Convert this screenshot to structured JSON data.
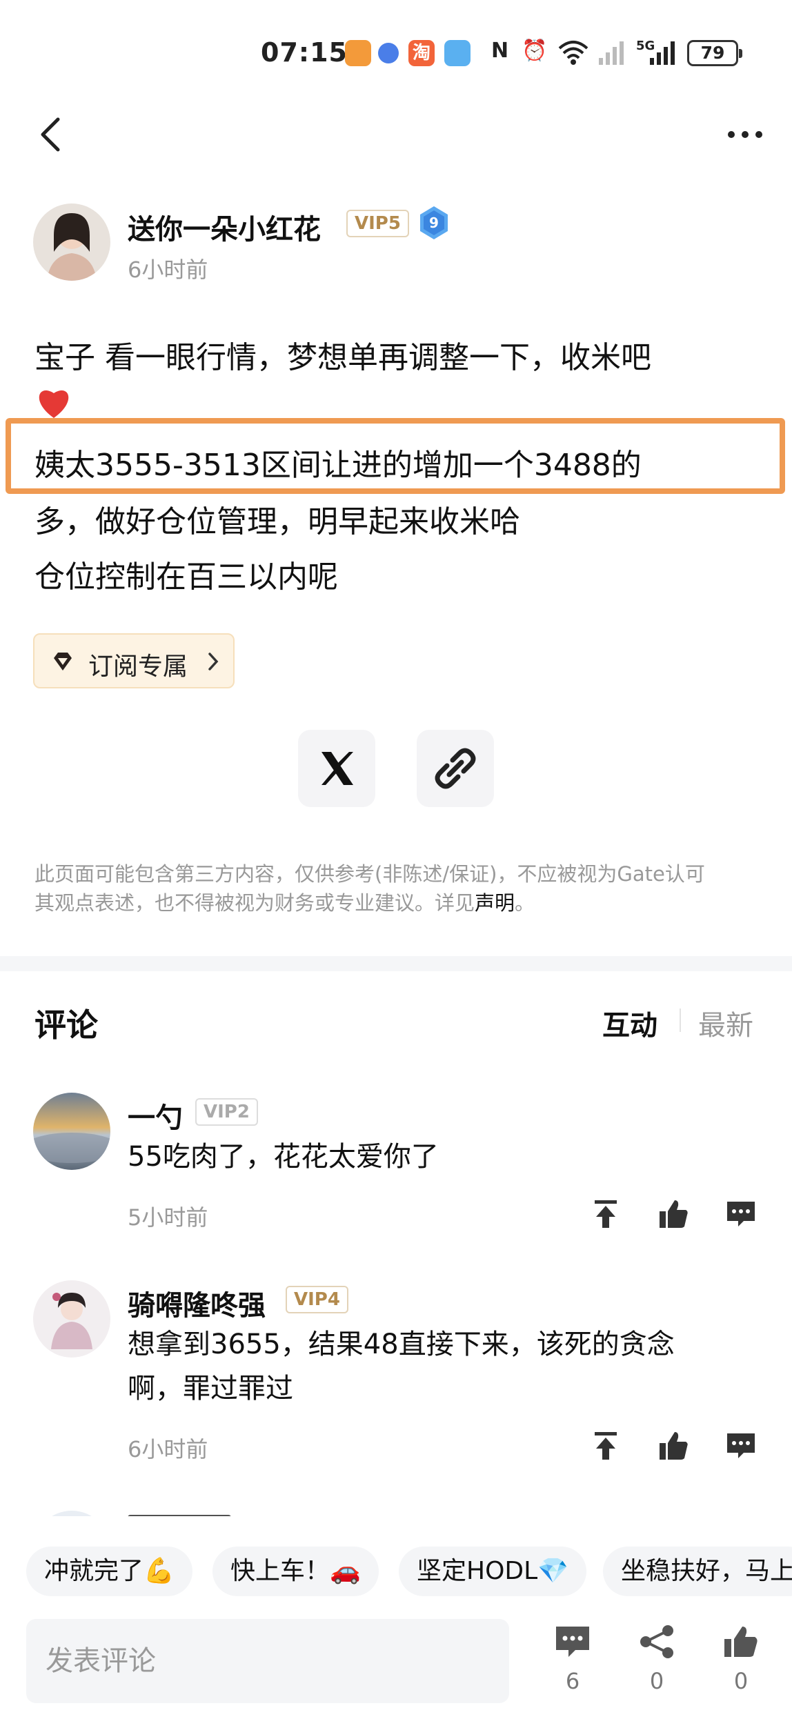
{
  "status_bar": {
    "time": "07:15",
    "battery": "79",
    "network": "5G"
  },
  "author": {
    "name": "送你一朵小红花",
    "vip": "VIP5",
    "level": "9",
    "time": "6小时前"
  },
  "post": {
    "lines": [
      "宝子 看一眼行情，梦想单再调整一下，收米吧",
      "姨太3555-3513区间让进的增加一个3488的",
      "多，做好仓位管理，明早起来收米哈",
      "仓位控制在百三以内呢"
    ]
  },
  "subscribe_label": "订阅专属",
  "disclaimer": {
    "line1": "此页面可能包含第三方内容，仅供参考(非陈述/保证)，不应被视为Gate认可",
    "line2_prefix": "其观点表述，也不得被视为财务或专业建议。详见",
    "link": "声明",
    "suffix": "。"
  },
  "comments_section": {
    "title": "评论",
    "sort_hot": "互动",
    "sort_new": "最新"
  },
  "comments": [
    {
      "name": "一勺",
      "vip": "VIP2",
      "text_lines": [
        "55吃肉了，花花太爱你了"
      ],
      "time": "5小时前"
    },
    {
      "name": "骑嘚隆咚强",
      "vip": "VIP4",
      "text_lines": [
        "想拿到3655，结果48直接下来，该死的贪念",
        "啊，罪过罪过"
      ],
      "time": "6小时前"
    }
  ],
  "quick_replies": [
    "冲就完了💪",
    "快上车！🚗",
    "坚定HODL💎",
    "坐稳扶好，马上"
  ],
  "bottom_bar": {
    "input_placeholder": "发表评论",
    "comment_count": "6",
    "share_count": "0",
    "like_count": "0"
  },
  "colors": {
    "highlight": "#ef9a52",
    "vip_gold": "#b38a4d",
    "vip_gray": "#aaaaaa",
    "level_blue": "#4a90e2"
  }
}
